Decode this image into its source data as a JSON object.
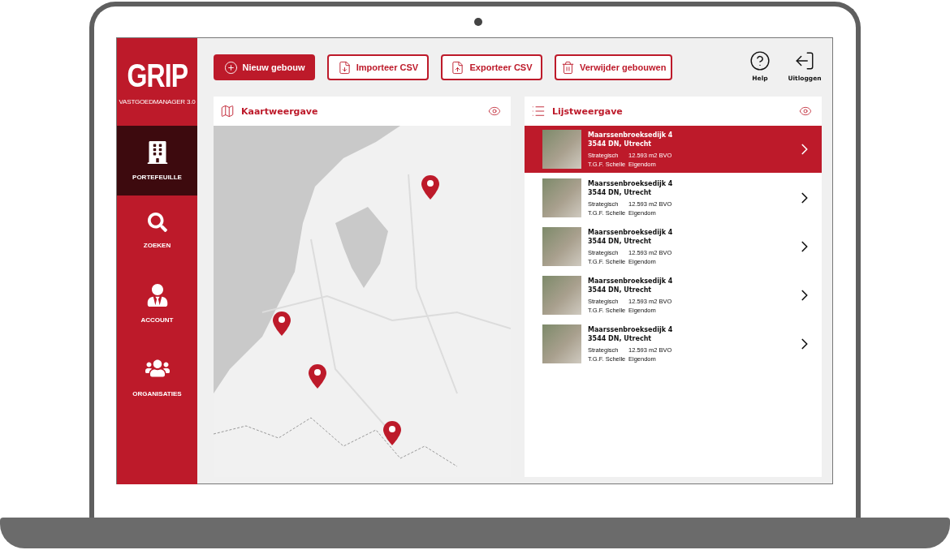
{
  "app": {
    "logo": "GRIP",
    "subtitle": "VASTGOEDMANAGER 3.0"
  },
  "sidebar": {
    "items": [
      {
        "kind": "buildings",
        "label": "PORTEFEUILLE",
        "selected": true
      },
      {
        "kind": "search",
        "label": "ZOEKEN",
        "selected": false
      },
      {
        "kind": "account",
        "label": "ACCOUNT",
        "selected": false
      },
      {
        "kind": "organizations",
        "label": "ORGANISATIES",
        "selected": false
      }
    ]
  },
  "toolbar": {
    "buttons": [
      {
        "kind": "add",
        "label": "Nieuw gebouw",
        "primary": true
      },
      {
        "kind": "import",
        "label": "Importeer CSV",
        "primary": false
      },
      {
        "kind": "export",
        "label": "Exporteer CSV",
        "primary": false
      },
      {
        "kind": "delete",
        "label": "Verwijder gebouwen",
        "primary": false
      }
    ],
    "actions": [
      {
        "kind": "help",
        "label": "Help"
      },
      {
        "kind": "logout",
        "label": "Uitloggen"
      }
    ]
  },
  "map_panel": {
    "title": "Kaartweergave"
  },
  "list_panel": {
    "title": "Lijstweergave",
    "rows": [
      {
        "address": "Maarssenbroeksedijk 4",
        "city": "3544 DN, Utrecht",
        "category": "Strategisch",
        "area": "12.593 m2 BVO",
        "owner": "T.G.F. Schelle",
        "ownership": "Eigendom",
        "selected": true
      },
      {
        "address": "Maarssenbroeksedijk 4",
        "city": "3544 DN, Utrecht",
        "category": "Strategisch",
        "area": "12.593 m2 BVO",
        "owner": "T.G.F. Schelle",
        "ownership": "Eigendom",
        "selected": false
      },
      {
        "address": "Maarssenbroeksedijk 4",
        "city": "3544 DN, Utrecht",
        "category": "Strategisch",
        "area": "12.593 m2 BVO",
        "owner": "T.G.F. Schelle",
        "ownership": "Eigendom",
        "selected": false
      },
      {
        "address": "Maarssenbroeksedijk 4",
        "city": "3544 DN, Utrecht",
        "category": "Strategisch",
        "area": "12.593 m2 BVO",
        "owner": "T.G.F. Schelle",
        "ownership": "Eigendom",
        "selected": false
      },
      {
        "address": "Maarssenbroeksedijk 4",
        "city": "3544 DN, Utrecht",
        "category": "Strategisch",
        "area": "12.593 m2 BVO",
        "owner": "T.G.F. Schelle",
        "ownership": "Eigendom",
        "selected": false
      }
    ]
  }
}
